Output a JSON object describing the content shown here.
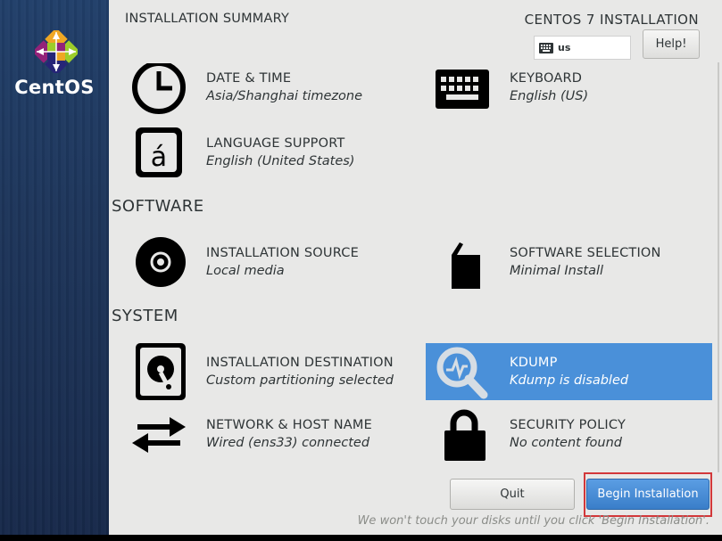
{
  "sidebar": {
    "brand": "CentOS"
  },
  "header": {
    "page_title": "INSTALLATION SUMMARY",
    "product_title": "CENTOS 7 INSTALLATION",
    "keyboard_layout": "us",
    "help_label": "Help!"
  },
  "sections": {
    "software": "SOFTWARE",
    "system": "SYSTEM"
  },
  "spokes": {
    "date_time": {
      "title": "DATE & TIME",
      "status": "Asia/Shanghai timezone",
      "icon": "clock-icon"
    },
    "keyboard": {
      "title": "KEYBOARD",
      "status": "English (US)",
      "icon": "keyboard-icon"
    },
    "language": {
      "title": "LANGUAGE SUPPORT",
      "status": "English (United States)",
      "icon": "language-icon"
    },
    "install_source": {
      "title": "INSTALLATION SOURCE",
      "status": "Local media",
      "icon": "disc-icon"
    },
    "software_selection": {
      "title": "SOFTWARE SELECTION",
      "status": "Minimal Install",
      "icon": "package-icon"
    },
    "install_destination": {
      "title": "INSTALLATION DESTINATION",
      "status": "Custom partitioning selected",
      "icon": "harddisk-icon"
    },
    "kdump": {
      "title": "KDUMP",
      "status": "Kdump is disabled",
      "icon": "search-icon"
    },
    "network": {
      "title": "NETWORK & HOST NAME",
      "status": "Wired (ens33) connected",
      "icon": "network-arrows-icon"
    },
    "security": {
      "title": "SECURITY POLICY",
      "status": "No content found",
      "icon": "lock-icon"
    }
  },
  "footer": {
    "quit_label": "Quit",
    "begin_label": "Begin Installation",
    "note": "We won't touch your disks until you click 'Begin Installation'."
  },
  "colors": {
    "selected": "#4a90d9",
    "primary_button": "#3a7ec9",
    "highlight_box": "#d2383a"
  }
}
